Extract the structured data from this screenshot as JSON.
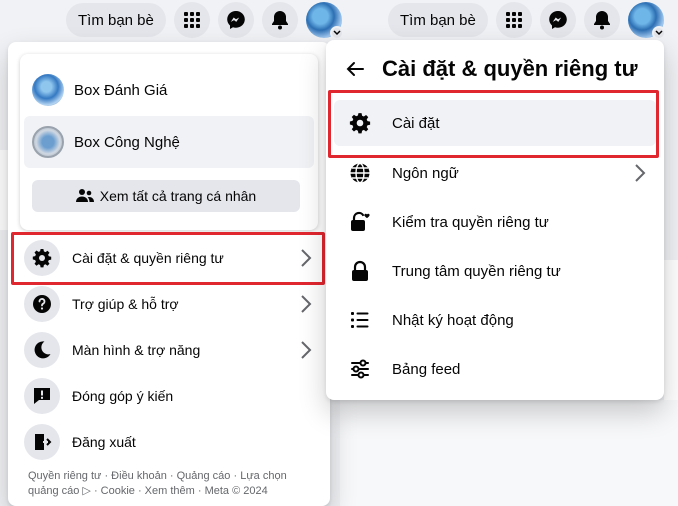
{
  "topbar": {
    "find_friends": "Tìm bạn bè"
  },
  "profiles": {
    "items": [
      {
        "name": "Box Đánh Giá"
      },
      {
        "name": "Box Công Nghệ"
      }
    ],
    "see_all": "Xem tất cả trang cá nhân"
  },
  "menu": {
    "items": [
      {
        "label": "Cài đặt & quyền riêng tư",
        "icon": "gear-icon"
      },
      {
        "label": "Trợ giúp & hỗ trợ",
        "icon": "help-icon"
      },
      {
        "label": "Màn hình & trợ năng",
        "icon": "moon-icon"
      },
      {
        "label": "Đóng góp ý kiến",
        "icon": "feedback-icon"
      },
      {
        "label": "Đăng xuất",
        "icon": "logout-icon"
      }
    ]
  },
  "footer": {
    "line1": "Quyền riêng tư · Điều khoản · Quảng cáo · Lựa chọn",
    "line2": "quảng cáo ▷ · Cookie · Xem thêm · Meta © 2024"
  },
  "settings_panel": {
    "title": "Cài đặt & quyền riêng tư",
    "items": [
      {
        "label": "Cài đặt",
        "icon": "gear-icon"
      },
      {
        "label": "Ngôn ngữ",
        "icon": "globe-icon"
      },
      {
        "label": "Kiểm tra quyền riêng tư",
        "icon": "lock-heart-icon"
      },
      {
        "label": "Trung tâm quyền riêng tư",
        "icon": "lock-icon"
      },
      {
        "label": "Nhật ký hoạt động",
        "icon": "list-icon"
      },
      {
        "label": "Bảng feed",
        "icon": "feed-icon"
      }
    ]
  },
  "colors": {
    "highlight": "#e0262f",
    "icon_bg": "#e4e6eb",
    "page_bg": "#f0f2f5"
  }
}
